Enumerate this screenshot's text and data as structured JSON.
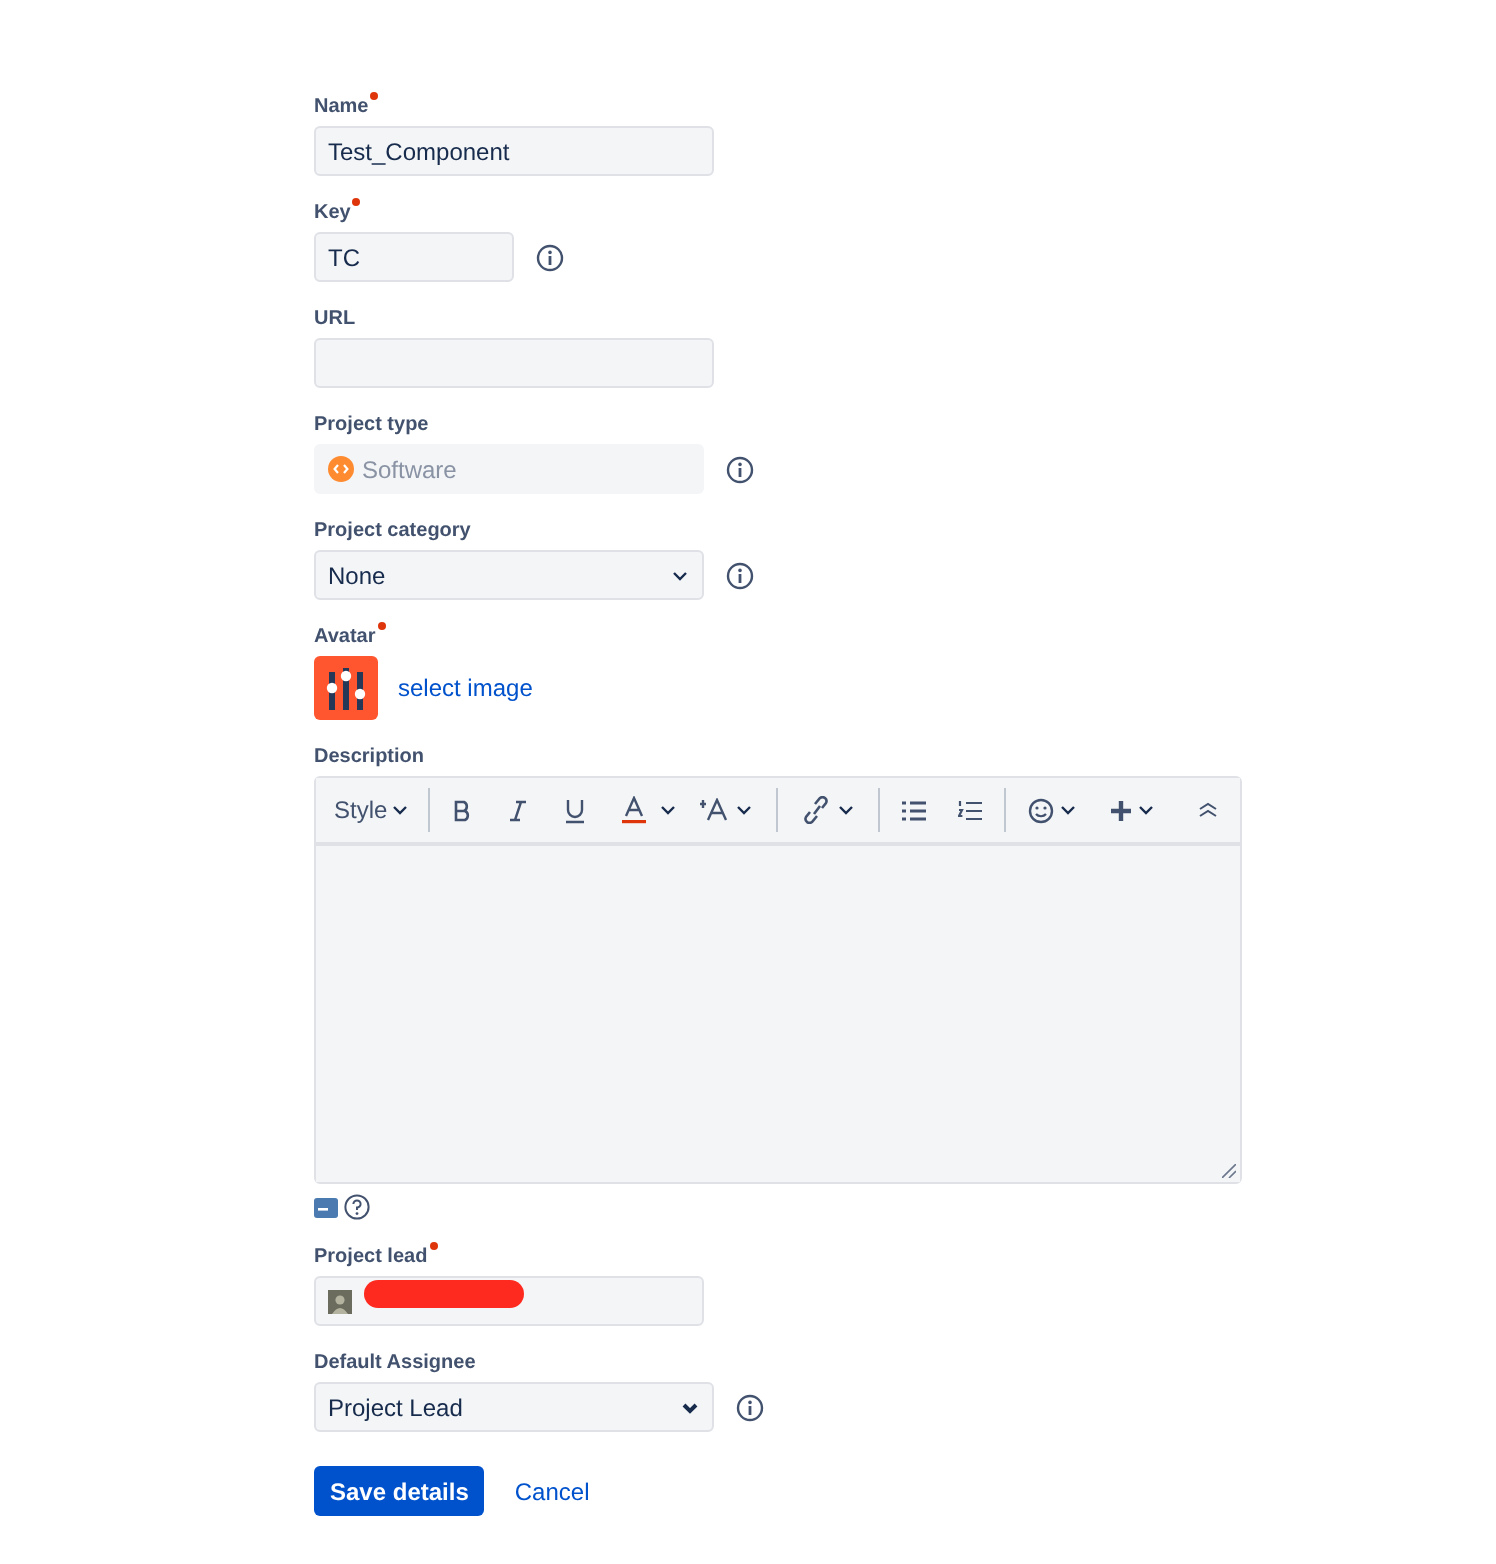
{
  "fields": [
    {
      "kind": "text",
      "label": "Name",
      "required": true,
      "value": "Test_Component",
      "info": false
    },
    {
      "kind": "short",
      "label": "Key",
      "required": true,
      "value": "TC",
      "info": true
    },
    {
      "kind": "text",
      "label": "URL",
      "required": false,
      "info": false
    },
    {
      "kind": "type",
      "label": "Project type",
      "required": false,
      "value": "Software",
      "disabled": true,
      "info": true
    },
    {
      "kind": "select",
      "label": "Project category",
      "required": false,
      "value": "None",
      "info": true
    },
    {
      "kind": "avatar",
      "label": "Avatar",
      "required": true,
      "link": "select image"
    },
    {
      "kind": "editor",
      "label": "Description",
      "required": false,
      "toolbar": {
        "style": "Style"
      }
    },
    {
      "kind": "user",
      "label": "Project lead",
      "required": true,
      "redacted": true
    },
    {
      "kind": "select2",
      "label": "Default Assignee",
      "required": false,
      "value": "Project Lead",
      "info": true
    }
  ],
  "buttons": {
    "save": "Save details",
    "cancel": "Cancel"
  }
}
